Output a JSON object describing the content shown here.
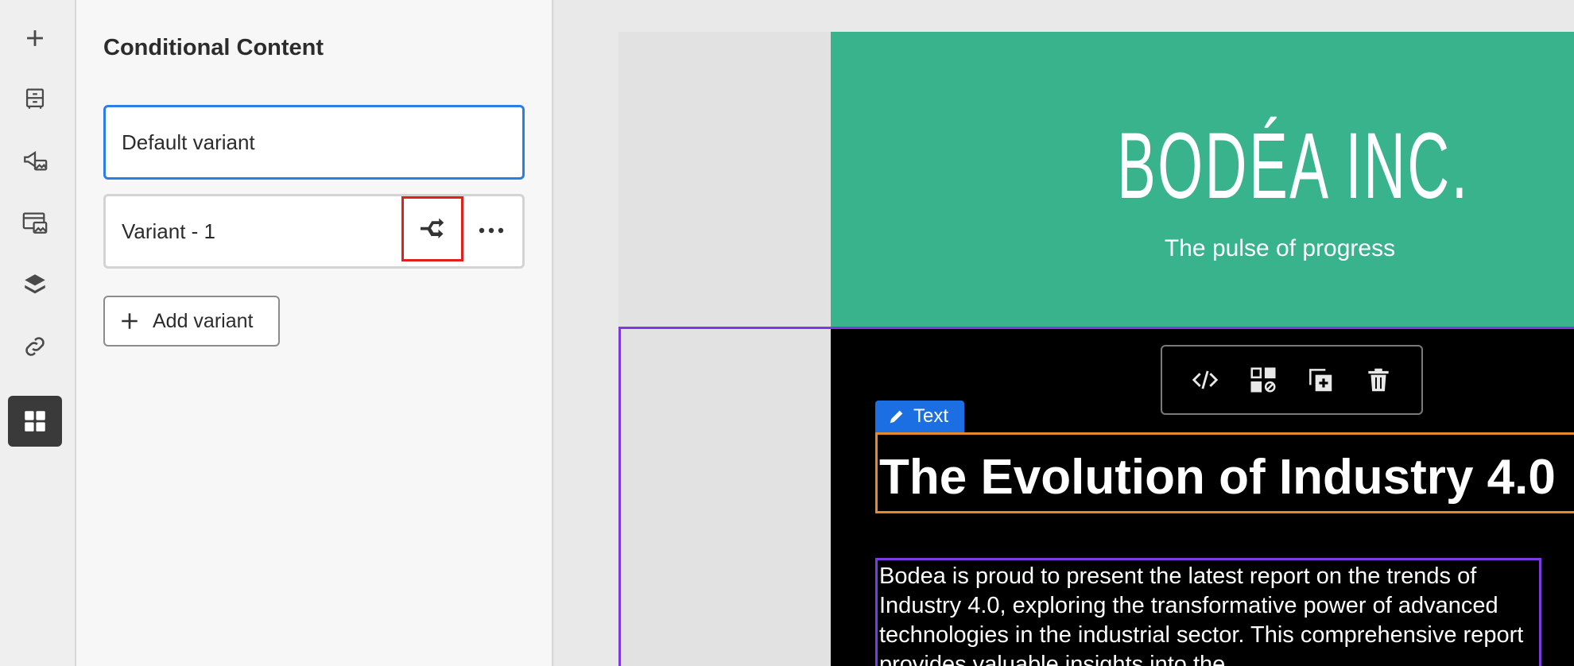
{
  "rail": {
    "items": [
      {
        "name": "add-icon",
        "active": false
      },
      {
        "name": "structure-icon",
        "active": false
      },
      {
        "name": "campaign-icon",
        "active": false
      },
      {
        "name": "assets-icon",
        "active": false
      },
      {
        "name": "layers-icon",
        "active": false
      },
      {
        "name": "link-icon",
        "active": false
      },
      {
        "name": "conditional-content-icon",
        "active": true
      }
    ]
  },
  "panel": {
    "title": "Conditional Content",
    "variants": [
      {
        "label": "Default variant",
        "selected": true
      },
      {
        "label": "Variant - 1",
        "selected": false
      }
    ],
    "add_label": "Add variant"
  },
  "canvas": {
    "logo": "BODÉA INC.",
    "tagline": "The pulse of progress",
    "text_tag": "Text",
    "heading": "The Evolution of Industry 4.0",
    "body": "Bodea is proud to present the latest report on the trends of Industry 4.0, exploring the transformative power of advanced technologies in the industrial sector. This comprehensive report provides valuable insights into the"
  },
  "colors": {
    "hero": "#38b38c",
    "selection": "#2a7ee6",
    "highlight": "#e0211b",
    "component_frame": "#7c3ae0",
    "text_frame": "#e6892a",
    "text_tag": "#1b6fe3"
  }
}
